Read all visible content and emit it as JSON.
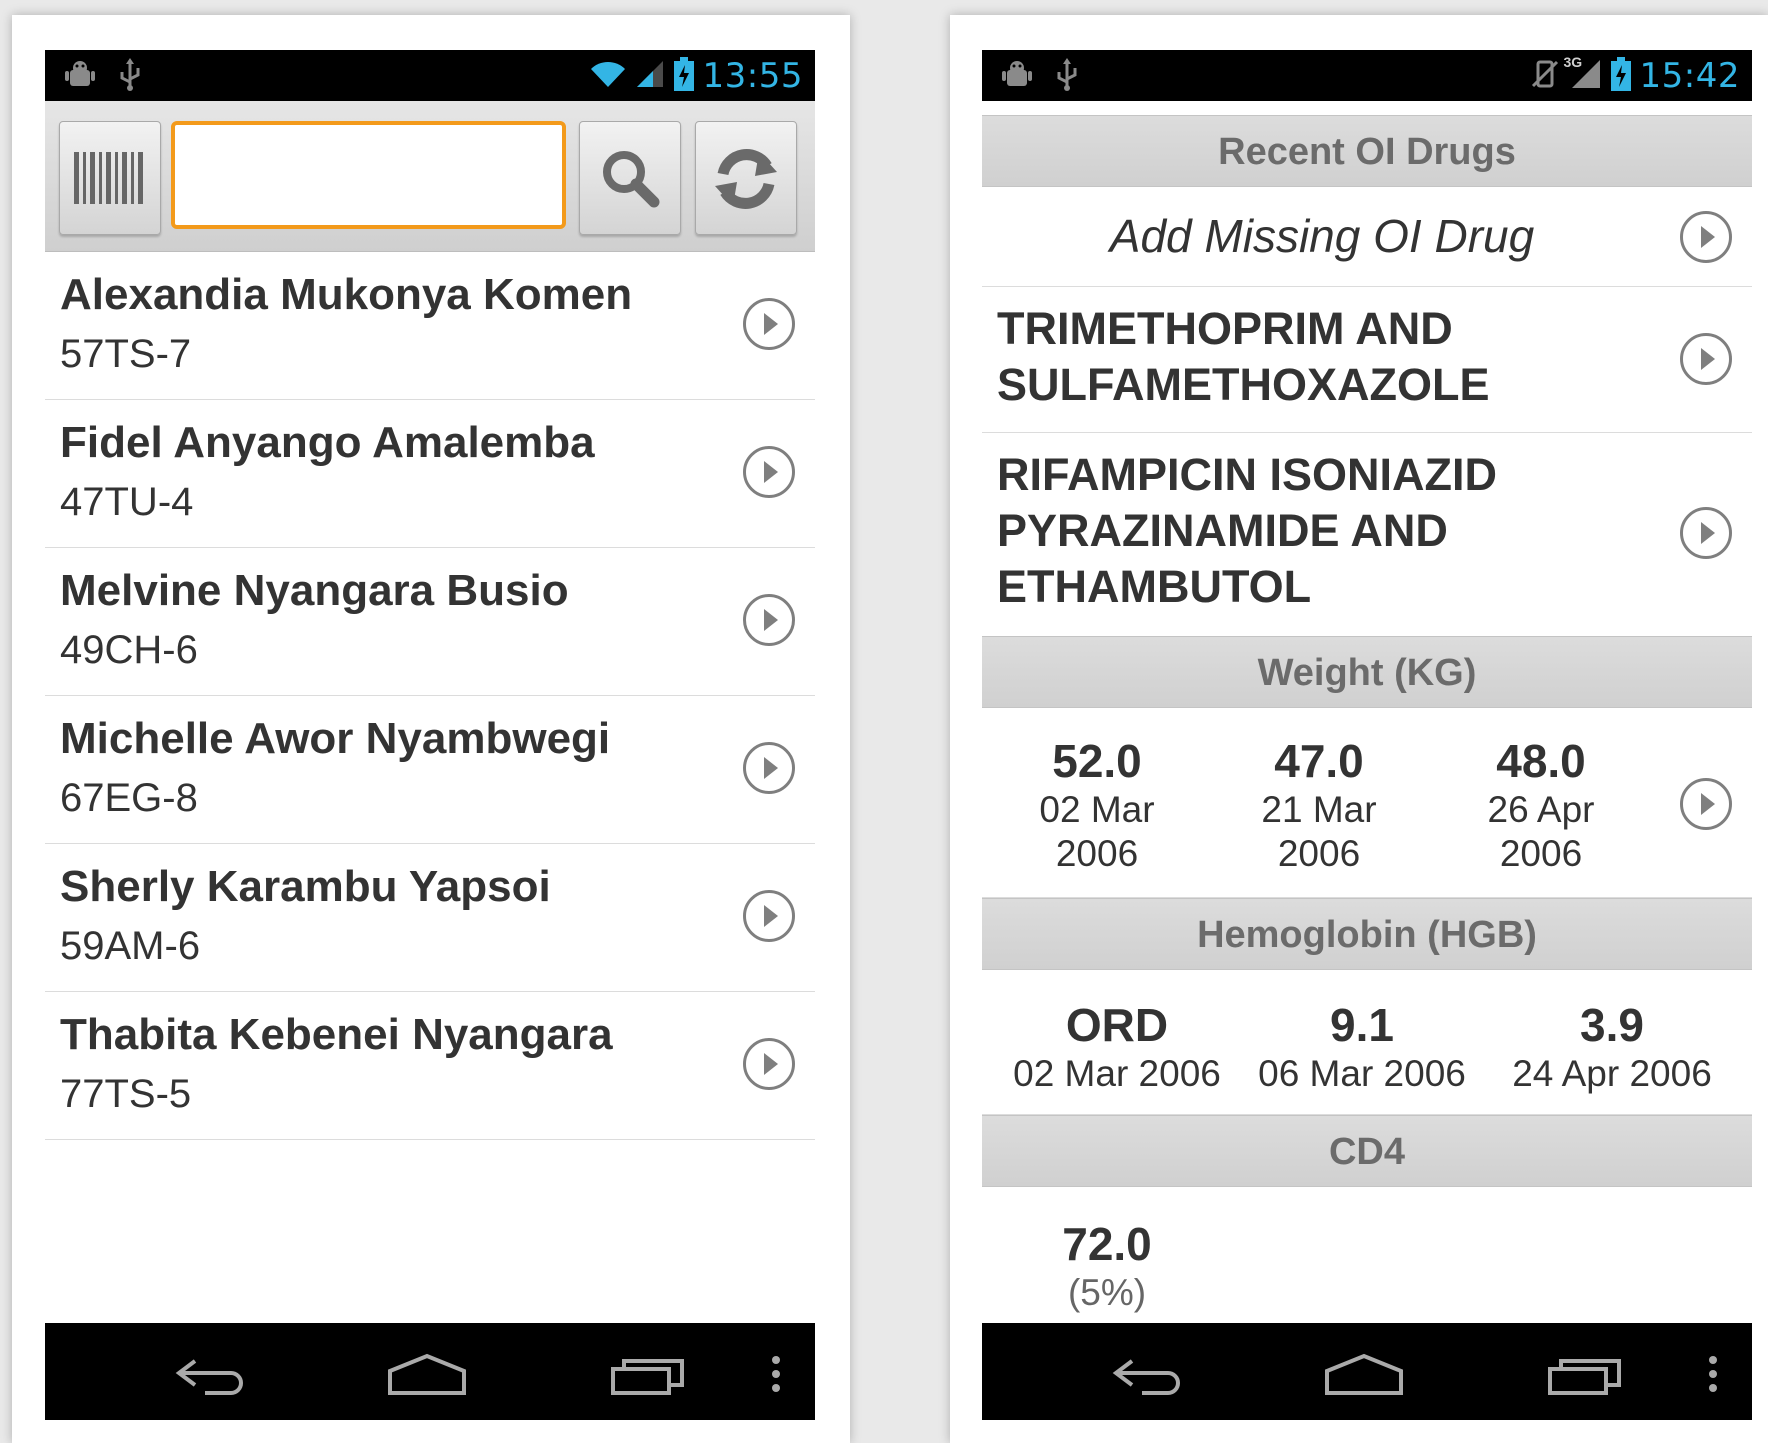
{
  "left_phone": {
    "status_bar": {
      "time": "13:55"
    },
    "search": {
      "value": ""
    },
    "patients": [
      {
        "name": "Alexandia Mukonya Komen",
        "id": "57TS-7"
      },
      {
        "name": "Fidel Anyango Amalemba",
        "id": "47TU-4"
      },
      {
        "name": "Melvine Nyangara Busio",
        "id": "49CH-6"
      },
      {
        "name": "Michelle Awor Nyambwegi",
        "id": "67EG-8"
      },
      {
        "name": "Sherly Karambu Yapsoi",
        "id": "59AM-6"
      },
      {
        "name": "Thabita Kebenei Nyangara",
        "id": "77TS-5"
      }
    ]
  },
  "right_phone": {
    "status_bar": {
      "time": "15:42",
      "network": "3G"
    },
    "recent_oi_drugs": {
      "header": "Recent OI Drugs",
      "add_label": "Add Missing OI Drug",
      "drugs": [
        {
          "line1": "TRIMETHOPRIM AND",
          "line2": "SULFAMETHOXAZOLE"
        },
        {
          "line1": "RIFAMPICIN ISONIAZID",
          "line2": "PYRAZINAMIDE AND",
          "line3": "ETHAMBUTOL"
        }
      ]
    },
    "weight": {
      "header": "Weight (KG)",
      "values": [
        {
          "value": "52.0",
          "date_line1": "02 Mar",
          "date_line2": "2006"
        },
        {
          "value": "47.0",
          "date_line1": "21 Mar",
          "date_line2": "2006"
        },
        {
          "value": "48.0",
          "date_line1": "26 Apr",
          "date_line2": "2006"
        }
      ]
    },
    "hemoglobin": {
      "header": "Hemoglobin (HGB)",
      "values": [
        {
          "value": "ORD",
          "date": "02 Mar 2006"
        },
        {
          "value": "9.1",
          "date": "06 Mar 2006"
        },
        {
          "value": "3.9",
          "date": "24 Apr 2006"
        }
      ]
    },
    "cd4": {
      "header": "CD4",
      "values": [
        {
          "value": "72.0",
          "percent": "(5%)"
        }
      ]
    }
  }
}
